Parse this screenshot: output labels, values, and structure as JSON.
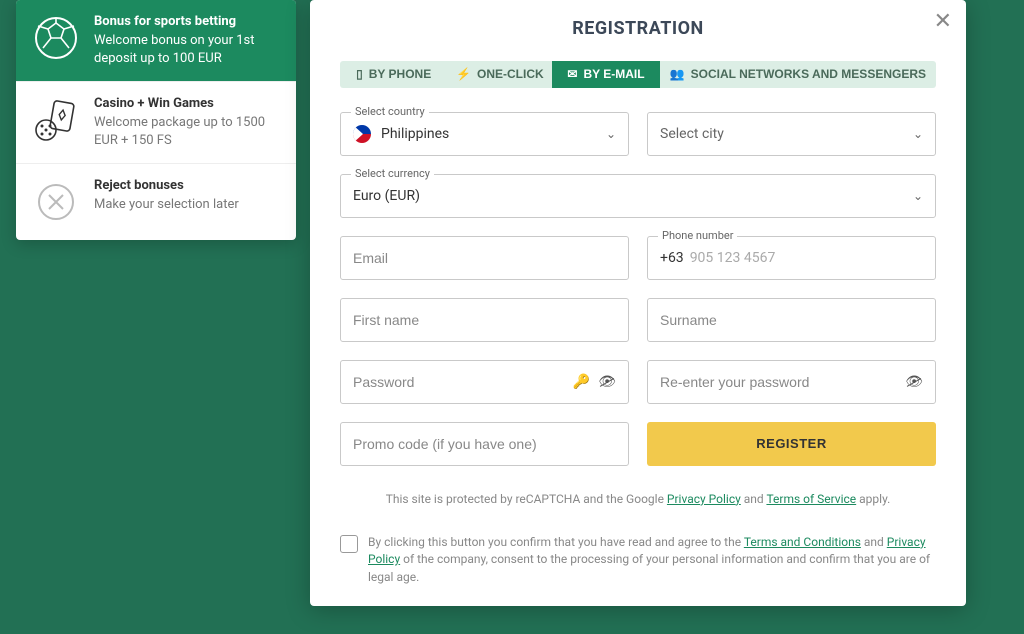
{
  "bonuses": {
    "sports": {
      "title": "Bonus for sports betting",
      "subtitle": "Welcome bonus on your 1st deposit up to 100 EUR"
    },
    "casino": {
      "title": "Casino + Win Games",
      "subtitle": "Welcome package up to 1500 EUR + 150 FS"
    },
    "reject": {
      "title": "Reject bonuses",
      "subtitle": "Make your selection later"
    }
  },
  "modal": {
    "title": "REGISTRATION"
  },
  "tabs": {
    "phone": "BY PHONE",
    "oneclick": "ONE-CLICK",
    "email": "BY E-MAIL",
    "social": "SOCIAL NETWORKS AND MESSENGERS"
  },
  "fields": {
    "country_label": "Select country",
    "country_value": "Philippines",
    "city_placeholder": "Select city",
    "currency_label": "Select currency",
    "currency_value": "Euro (EUR)",
    "email_placeholder": "Email",
    "phone_label": "Phone number",
    "phone_prefix": "+63",
    "phone_placeholder": "905 123 4567",
    "firstname_placeholder": "First name",
    "surname_placeholder": "Surname",
    "password_placeholder": "Password",
    "repassword_placeholder": "Re-enter your password",
    "promo_placeholder": "Promo code (if you have one)"
  },
  "register_label": "REGISTER",
  "recaptcha": {
    "pre": "This site is protected by reCAPTCHA and the Google ",
    "privacy": "Privacy Policy",
    "mid": " and ",
    "tos": "Terms of Service",
    "post": " apply."
  },
  "terms": {
    "pre": "By clicking this button you confirm that you have read and agree to the ",
    "tc": "Terms and Conditions",
    "mid": " and ",
    "pp": "Privacy Policy",
    "post": " of the company, consent to the processing of your personal information and confirm that you are of legal age."
  }
}
